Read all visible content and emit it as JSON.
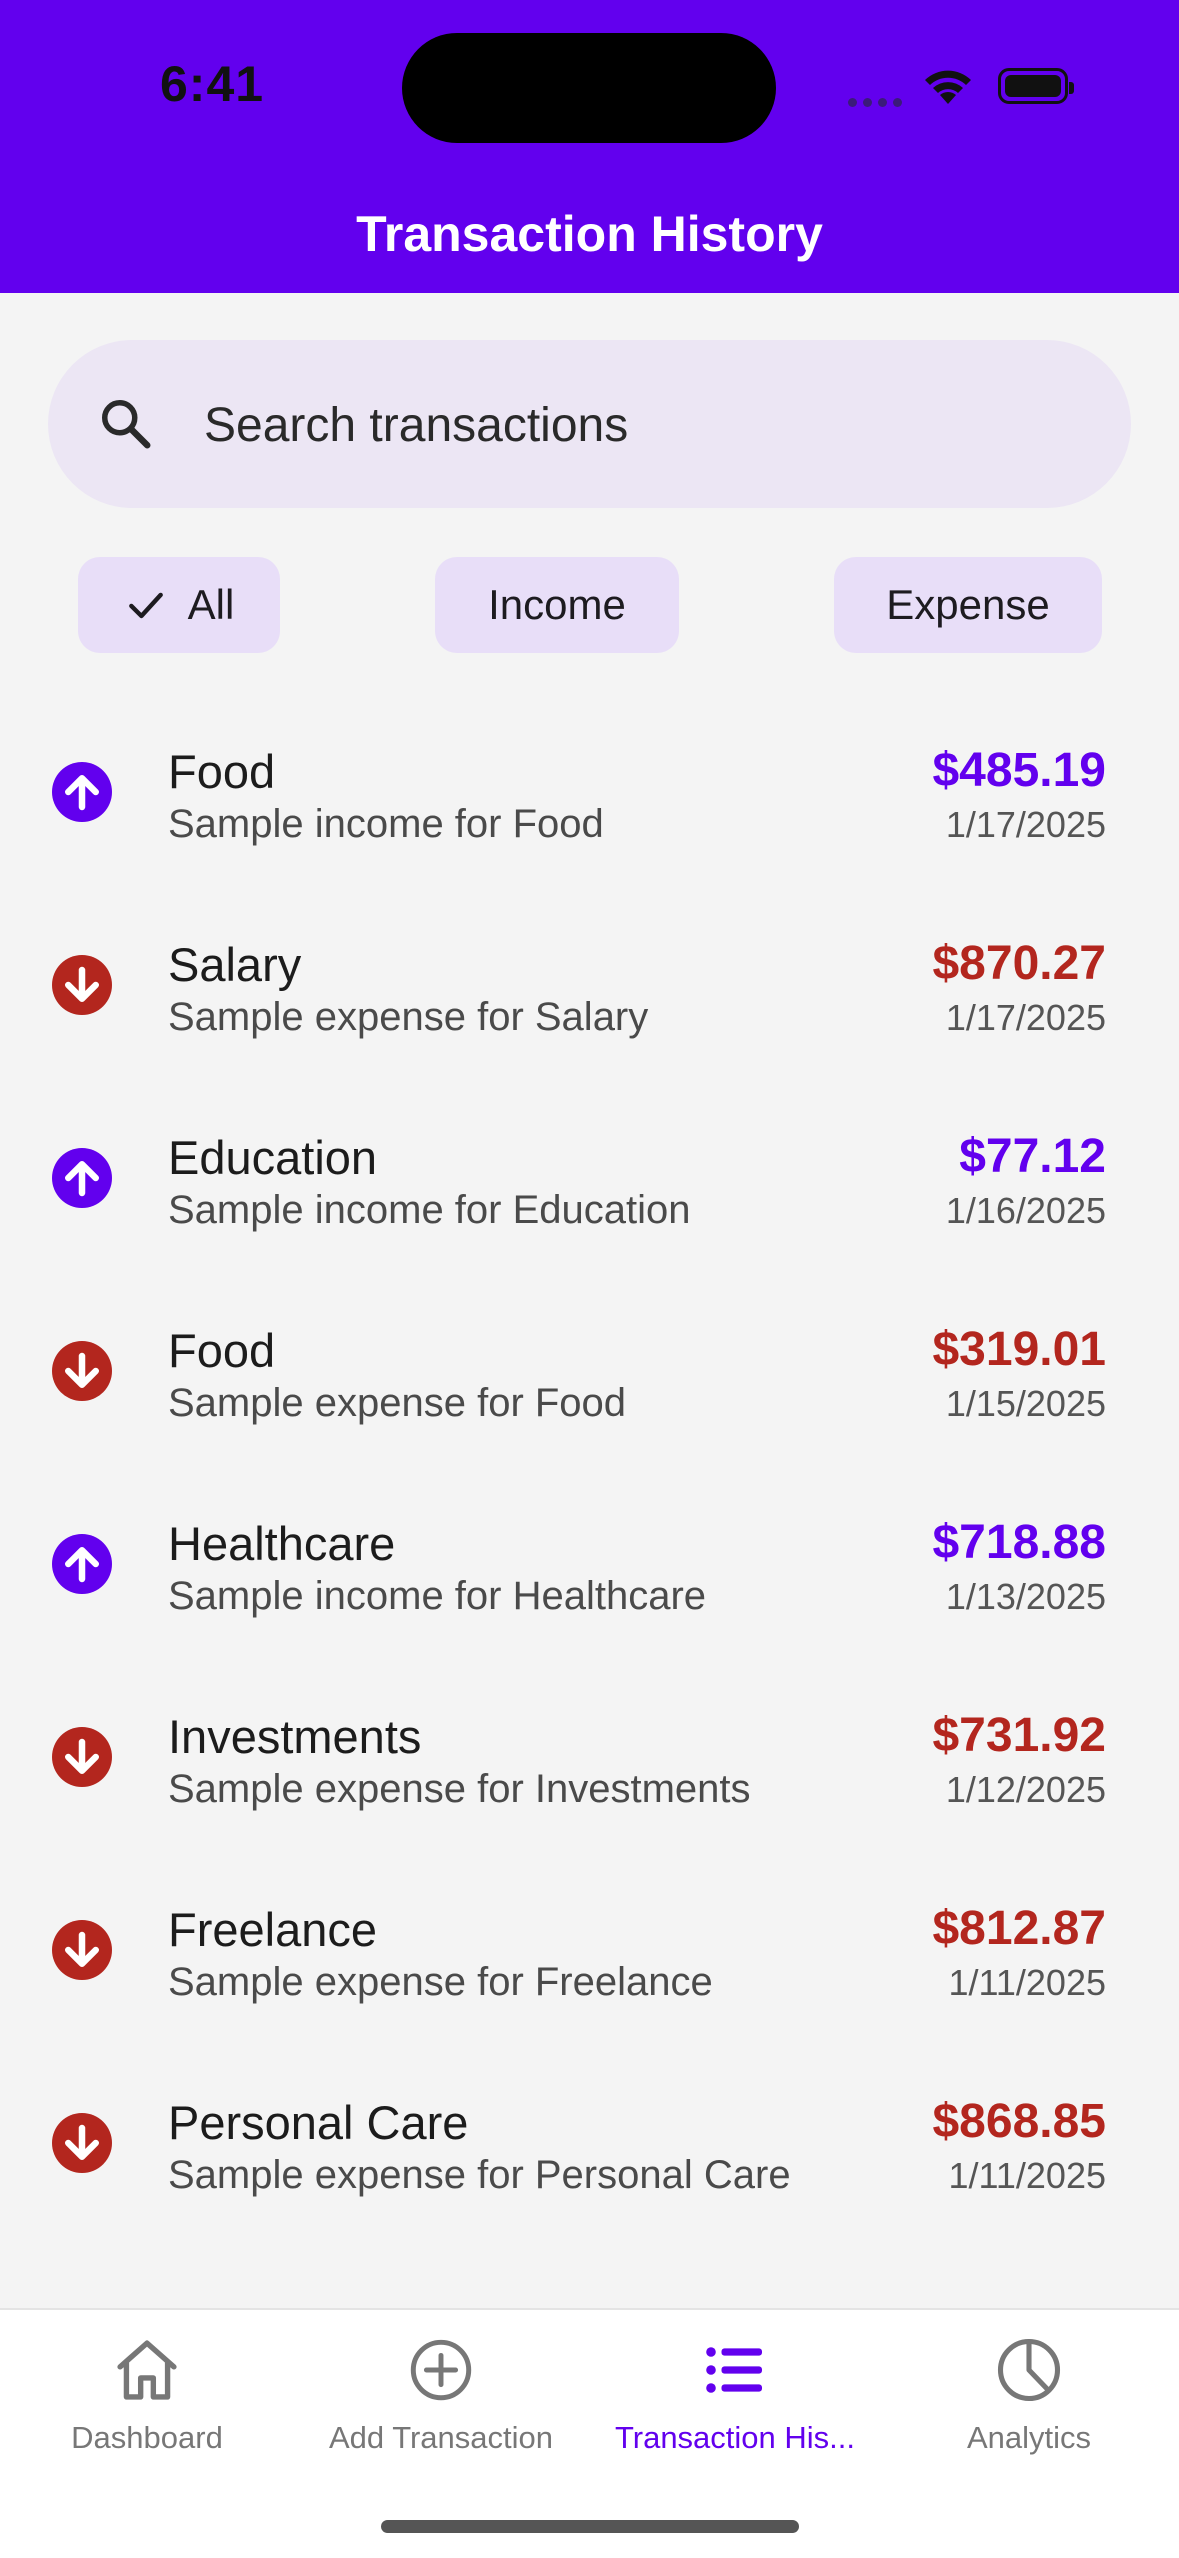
{
  "status_bar": {
    "time": "6:41"
  },
  "header": {
    "title": "Transaction History"
  },
  "search": {
    "placeholder": "Search transactions"
  },
  "filters": [
    {
      "label": "All",
      "selected": true
    },
    {
      "label": "Income",
      "selected": false
    },
    {
      "label": "Expense",
      "selected": false
    }
  ],
  "transactions": [
    {
      "type": "income",
      "category": "Food",
      "description": "Sample income for Food",
      "amount": "$485.19",
      "date": "1/17/2025"
    },
    {
      "type": "expense",
      "category": "Salary",
      "description": "Sample expense for Salary",
      "amount": "$870.27",
      "date": "1/17/2025"
    },
    {
      "type": "income",
      "category": "Education",
      "description": "Sample income for Education",
      "amount": "$77.12",
      "date": "1/16/2025"
    },
    {
      "type": "expense",
      "category": "Food",
      "description": "Sample expense for Food",
      "amount": "$319.01",
      "date": "1/15/2025"
    },
    {
      "type": "income",
      "category": "Healthcare",
      "description": "Sample income for Healthcare",
      "amount": "$718.88",
      "date": "1/13/2025"
    },
    {
      "type": "expense",
      "category": "Investments",
      "description": "Sample expense for Investments",
      "amount": "$731.92",
      "date": "1/12/2025"
    },
    {
      "type": "expense",
      "category": "Freelance",
      "description": "Sample expense for Freelance",
      "amount": "$812.87",
      "date": "1/11/2025"
    },
    {
      "type": "expense",
      "category": "Personal Care",
      "description": "Sample expense for Personal Care",
      "amount": "$868.85",
      "date": "1/11/2025"
    }
  ],
  "bottom_nav": [
    {
      "label": "Dashboard",
      "icon": "home-icon",
      "active": false
    },
    {
      "label": "Add Transaction",
      "icon": "add-circle-icon",
      "active": false
    },
    {
      "label": "Transaction His...",
      "icon": "list-icon",
      "active": true
    },
    {
      "label": "Analytics",
      "icon": "pie-chart-icon",
      "active": false
    }
  ],
  "colors": {
    "primary": "#6200ee",
    "income": "#6200ee",
    "expense": "#b3261e",
    "chip_bg": "#e8def8",
    "search_bg": "#ece6f4"
  }
}
